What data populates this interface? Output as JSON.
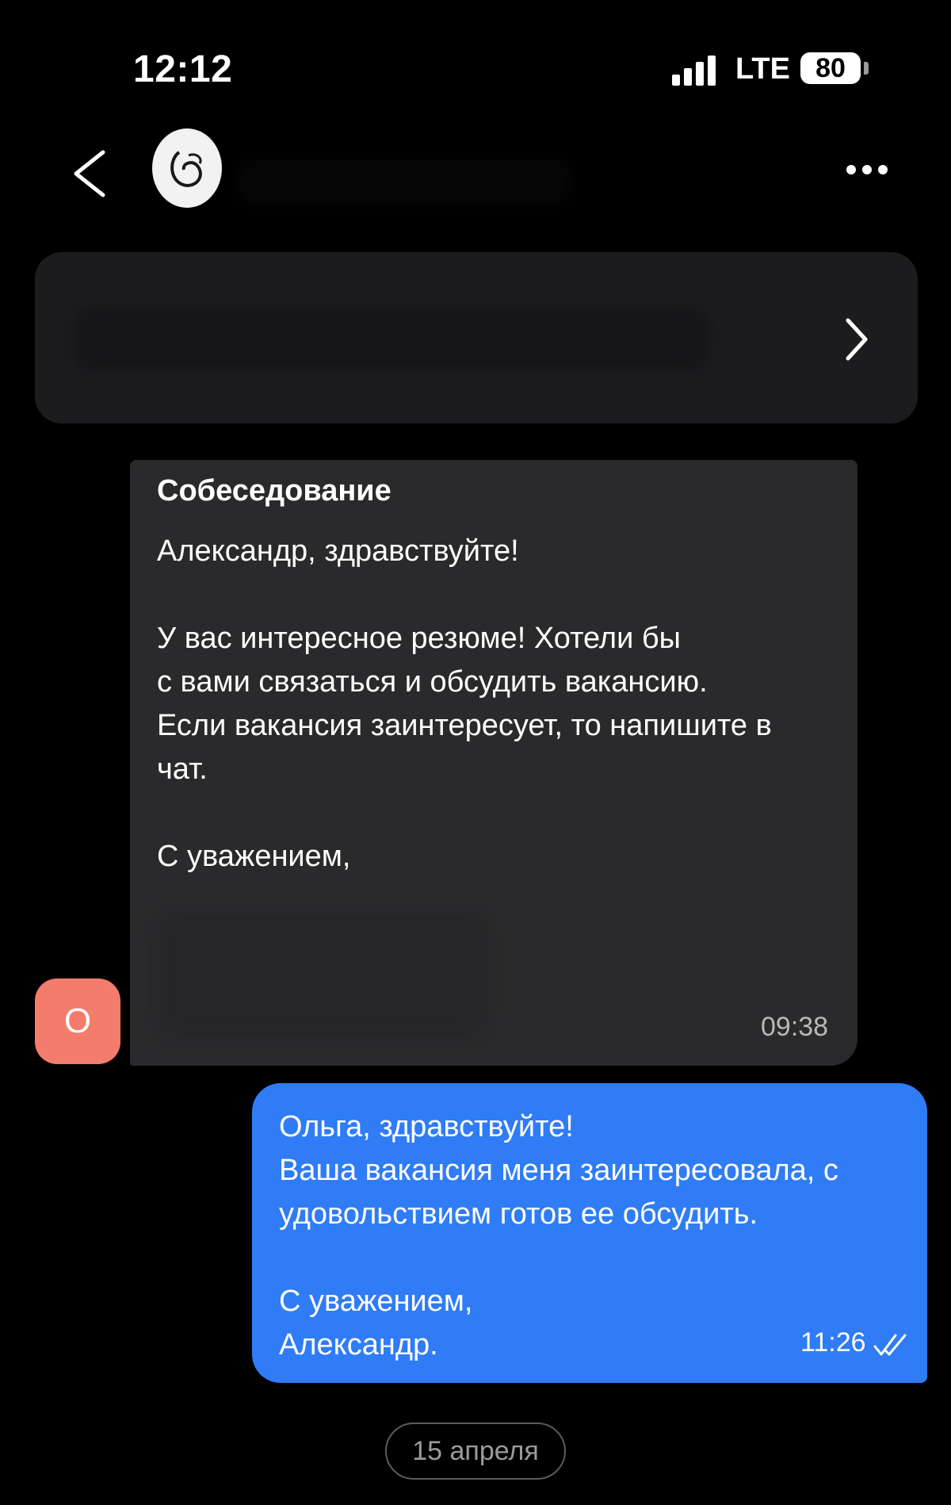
{
  "status_bar": {
    "time": "12:12",
    "network": "LTE",
    "battery": "80"
  },
  "header": {
    "back_icon": "chevron-left-icon",
    "avatar_icon": "company-logo",
    "more_icon": "more-horizontal-icon"
  },
  "vacancy_card": {
    "chevron_icon": "chevron-right-icon"
  },
  "messages": {
    "incoming": {
      "sender_initial": "О",
      "title": "Собеседование",
      "body": "Александр, здравствуйте!\n\nУ вас интересное резюме! Хотели бы\nс вами связаться и обсудить вакансию.\nЕсли вакансия заинтересует, то напишите в\nчат.\n\nС уважением,",
      "time": "09:38"
    },
    "outgoing": {
      "body": "Ольга, здравствуйте!\nВаша вакансия меня заинтересовала,  с\nудовольствием готов ее обсудить.\n\nС уважением,\nАлександр.",
      "time": "11:26",
      "status_icon": "double-check-icon"
    }
  },
  "date_separator": "15 апреля",
  "colors": {
    "background": "#000000",
    "incoming_bubble": "#2a2a2c",
    "outgoing_bubble": "#2f7cf6",
    "avatar_accent": "#f47c6c",
    "card": "#1c1c1e"
  }
}
